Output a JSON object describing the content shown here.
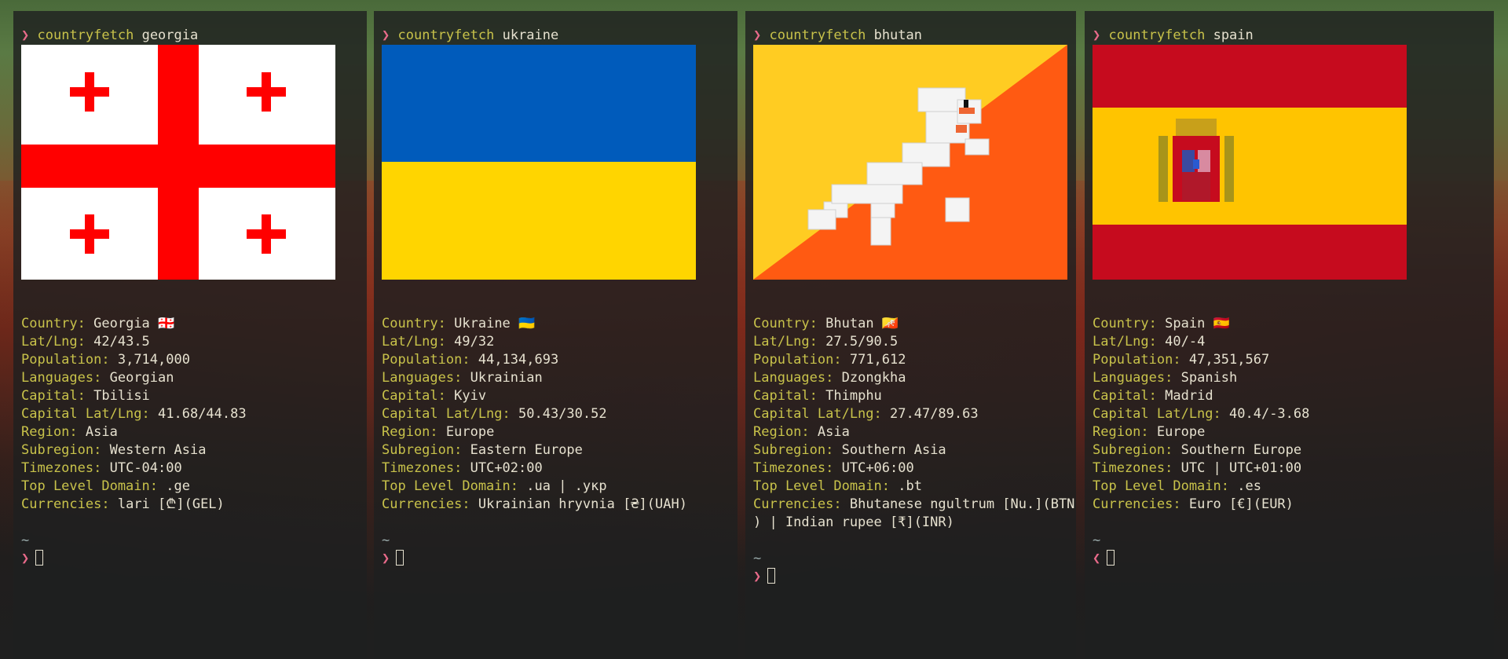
{
  "panes": [
    {
      "prompt": {
        "chevron": "❯",
        "command": "countryfetch",
        "argument": "georgia"
      },
      "flag_icon": "georgia-flag",
      "info": [
        {
          "key": "Country:",
          "value": "Georgia 🇬🇪"
        },
        {
          "key": "Lat/Lng:",
          "value": "42/43.5"
        },
        {
          "key": "Population:",
          "value": "3,714,000"
        },
        {
          "key": "Languages:",
          "value": "Georgian"
        },
        {
          "key": "Capital:",
          "value": "Tbilisi"
        },
        {
          "key": "Capital Lat/Lng:",
          "value": "41.68/44.83"
        },
        {
          "key": "Region:",
          "value": "Asia"
        },
        {
          "key": "Subregion:",
          "value": "Western Asia"
        },
        {
          "key": "Timezones:",
          "value": "UTC-04:00"
        },
        {
          "key": "Top Level Domain:",
          "value": ".ge"
        },
        {
          "key": "Currencies:",
          "value": "lari [₾](GEL)"
        }
      ],
      "tilde": "~",
      "next_prompt": "❯"
    },
    {
      "prompt": {
        "chevron": "❯",
        "command": "countryfetch",
        "argument": "ukraine"
      },
      "flag_icon": "ukraine-flag",
      "info": [
        {
          "key": "Country:",
          "value": "Ukraine 🇺🇦"
        },
        {
          "key": "Lat/Lng:",
          "value": "49/32"
        },
        {
          "key": "Population:",
          "value": "44,134,693"
        },
        {
          "key": "Languages:",
          "value": "Ukrainian"
        },
        {
          "key": "Capital:",
          "value": "Kyiv"
        },
        {
          "key": "Capital Lat/Lng:",
          "value": "50.43/30.52"
        },
        {
          "key": "Region:",
          "value": "Europe"
        },
        {
          "key": "Subregion:",
          "value": "Eastern Europe"
        },
        {
          "key": "Timezones:",
          "value": "UTC+02:00"
        },
        {
          "key": "Top Level Domain:",
          "value": ".ua | .укр"
        },
        {
          "key": "Currencies:",
          "value": "Ukrainian hryvnia [₴](UAH)"
        }
      ],
      "tilde": "~",
      "next_prompt": "❯"
    },
    {
      "prompt": {
        "chevron": "❯",
        "command": "countryfetch",
        "argument": "bhutan"
      },
      "flag_icon": "bhutan-flag",
      "info": [
        {
          "key": "Country:",
          "value": "Bhutan 🇧🇹"
        },
        {
          "key": "Lat/Lng:",
          "value": "27.5/90.5"
        },
        {
          "key": "Population:",
          "value": "771,612"
        },
        {
          "key": "Languages:",
          "value": "Dzongkha"
        },
        {
          "key": "Capital:",
          "value": "Thimphu"
        },
        {
          "key": "Capital Lat/Lng:",
          "value": "27.47/89.63"
        },
        {
          "key": "Region:",
          "value": "Asia"
        },
        {
          "key": "Subregion:",
          "value": "Southern Asia"
        },
        {
          "key": "Timezones:",
          "value": "UTC+06:00"
        },
        {
          "key": "Top Level Domain:",
          "value": ".bt"
        },
        {
          "key": "Currencies:",
          "value": "Bhutanese ngultrum [Nu.](BTN"
        },
        {
          "key": "",
          "value": ") | Indian rupee [₹](INR)"
        }
      ],
      "tilde": "~",
      "next_prompt": "❯"
    },
    {
      "prompt": {
        "chevron": "❯",
        "command": "countryfetch",
        "argument": "spain"
      },
      "flag_icon": "spain-flag",
      "info": [
        {
          "key": "Country:",
          "value": "Spain 🇪🇸"
        },
        {
          "key": "Lat/Lng:",
          "value": "40/-4"
        },
        {
          "key": "Population:",
          "value": "47,351,567"
        },
        {
          "key": "Languages:",
          "value": "Spanish"
        },
        {
          "key": "Capital:",
          "value": "Madrid"
        },
        {
          "key": "Capital Lat/Lng:",
          "value": "40.4/-3.68"
        },
        {
          "key": "Region:",
          "value": "Europe"
        },
        {
          "key": "Subregion:",
          "value": "Southern Europe"
        },
        {
          "key": "Timezones:",
          "value": "UTC | UTC+01:00"
        },
        {
          "key": "Top Level Domain:",
          "value": ".es"
        },
        {
          "key": "Currencies:",
          "value": "Euro [€](EUR)"
        }
      ],
      "tilde": "~",
      "next_prompt": "❮"
    }
  ]
}
